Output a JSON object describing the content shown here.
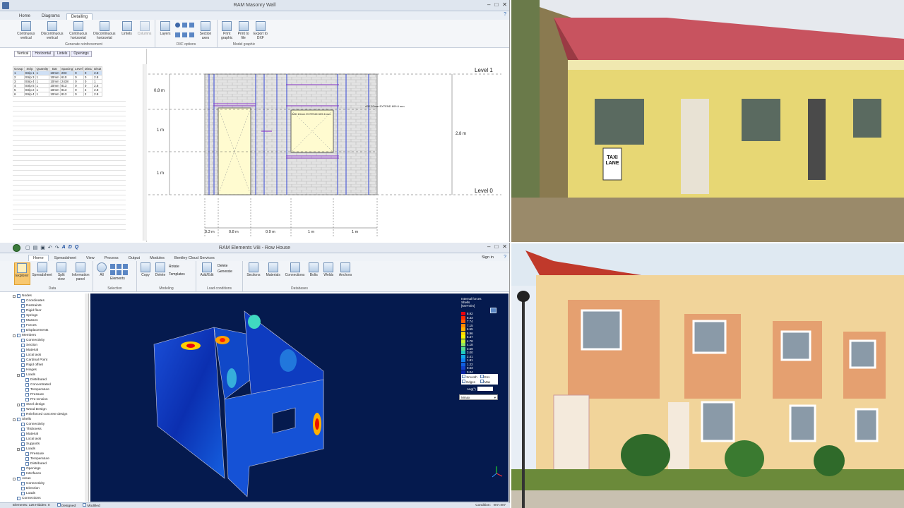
{
  "app1": {
    "title": "RAM Masonry Wall",
    "tabs": [
      "Home",
      "Diagrams",
      "Detailing"
    ],
    "ribbon_groups": [
      {
        "label": "Generate reinforcement",
        "buttons": [
          "Continuous vertical",
          "Discontinuous vertical",
          "Continuous horizontal",
          "Discontinuous horizontal",
          "Lintels",
          "Columns"
        ]
      },
      {
        "label": "DXF options",
        "buttons": [
          "Layers",
          "Section axes"
        ]
      },
      {
        "label": "Model graphic",
        "buttons": [
          "Print graphic",
          "Print to file",
          "Export to DXF"
        ]
      }
    ],
    "subtabs": [
      "Vertical",
      "Horizontal",
      "Lintels",
      "Openings"
    ],
    "table": {
      "headers": [
        "Group",
        "Strip",
        "Quantity",
        "Bar",
        "Spacing",
        "Level",
        "Dist1",
        "Dist2"
      ],
      "rows": [
        [
          "1",
          "Strip 1",
          "1",
          "10mm",
          "203",
          "0",
          "0",
          "2.8"
        ],
        [
          "2",
          "Strip 3",
          "1",
          "10mm",
          "610",
          "0",
          "0",
          "2.8"
        ],
        [
          "3",
          "Strip 4",
          "1",
          "10mm",
          "2438",
          "0",
          "0",
          "1"
        ],
        [
          "4",
          "Strip 5",
          "1",
          "10mm",
          "813",
          "0",
          "0",
          "2.8"
        ],
        [
          "5",
          "Strip 2",
          "1",
          "10mm",
          "813",
          "0",
          "2",
          "2.8"
        ],
        [
          "6",
          "Strip 4",
          "1",
          "10mm",
          "813",
          "0",
          "2",
          "2.8"
        ]
      ]
    },
    "drawing": {
      "level_top": "Level 1",
      "level_bottom": "Level 0",
      "dim_08": "0.8 m",
      "dim_1a": "1 m",
      "dim_1b": "1 m",
      "dim_total": "2.8 m",
      "bottom_dims": [
        "0.3 m",
        "0.8 m",
        "0.9 m",
        "1 m",
        "1 m"
      ],
      "note1": "A00 10mm EXTEND 609.6 mm",
      "note2": "A00 10mm EXTEND 609.6 mm"
    }
  },
  "app2": {
    "title": "RAM Elements V8i - Row House",
    "tabs": [
      "Home",
      "Spreadsheet",
      "View",
      "Process",
      "Output",
      "Modules",
      "Bentley Cloud Services"
    ],
    "signin": "Sign in",
    "ribbon_groups": [
      {
        "label": "Data",
        "buttons": [
          "Explorer",
          "Spreadsheet",
          "Split view",
          "Information panel"
        ]
      },
      {
        "label": "Selection",
        "buttons": [
          "All",
          "Elements"
        ]
      },
      {
        "label": "Modeling",
        "buttons": [
          "Copy",
          "Delete",
          "Rotate",
          "Templates"
        ]
      },
      {
        "label": "Load conditions",
        "buttons": [
          "Add/Edit",
          "Delete",
          "Generate"
        ]
      },
      {
        "label": "Databases",
        "buttons": [
          "Sections",
          "Materials",
          "Connections",
          "Bolts",
          "Welds",
          "Anchors"
        ]
      }
    ],
    "tree": [
      {
        "level": 0,
        "label": "Nodes",
        "expand": true
      },
      {
        "level": 1,
        "label": "Coordinates"
      },
      {
        "level": 1,
        "label": "Restraints"
      },
      {
        "level": 1,
        "label": "Rigid floor"
      },
      {
        "level": 1,
        "label": "Springs"
      },
      {
        "level": 1,
        "label": "Masses"
      },
      {
        "level": 1,
        "label": "Forces"
      },
      {
        "level": 1,
        "label": "Displacements"
      },
      {
        "level": 0,
        "label": "Members",
        "expand": true
      },
      {
        "level": 1,
        "label": "Connectivity"
      },
      {
        "level": 1,
        "label": "Section"
      },
      {
        "level": 1,
        "label": "Material"
      },
      {
        "level": 1,
        "label": "Local axis"
      },
      {
        "level": 1,
        "label": "Cardinal Point"
      },
      {
        "level": 1,
        "label": "Rigid offset"
      },
      {
        "level": 1,
        "label": "Hinges"
      },
      {
        "level": 1,
        "label": "Loads",
        "expand": true
      },
      {
        "level": 2,
        "label": "Distributed"
      },
      {
        "level": 2,
        "label": "Concentrated"
      },
      {
        "level": 2,
        "label": "Temperature"
      },
      {
        "level": 2,
        "label": "Pressure"
      },
      {
        "level": 2,
        "label": "Pre-tension"
      },
      {
        "level": 1,
        "label": "Steel design",
        "expand": true
      },
      {
        "level": 1,
        "label": "Wood Design"
      },
      {
        "level": 1,
        "label": "Reinforced concrete design"
      },
      {
        "level": 0,
        "label": "Shells",
        "expand": true
      },
      {
        "level": 1,
        "label": "Connectivity"
      },
      {
        "level": 1,
        "label": "Thickness"
      },
      {
        "level": 1,
        "label": "Material"
      },
      {
        "level": 1,
        "label": "Local axis"
      },
      {
        "level": 1,
        "label": "Supports"
      },
      {
        "level": 1,
        "label": "Loads",
        "expand": true
      },
      {
        "level": 2,
        "label": "Pressure"
      },
      {
        "level": 2,
        "label": "Temperature"
      },
      {
        "level": 2,
        "label": "Distributed"
      },
      {
        "level": 1,
        "label": "Openings"
      },
      {
        "level": 1,
        "label": "Interfaces"
      },
      {
        "level": 0,
        "label": "Areas",
        "expand": true
      },
      {
        "level": 1,
        "label": "Connectivity"
      },
      {
        "level": 1,
        "label": "Direction"
      },
      {
        "level": 1,
        "label": "Loads"
      },
      {
        "level": 0,
        "label": "Connections"
      }
    ],
    "legend": {
      "title": "Internal forces",
      "sub": "Shells",
      "unit": "[KN*m/m]",
      "values": [
        "8.92",
        "8.33",
        "7.74",
        "7.15",
        "6.55",
        "5.96",
        "5.37",
        "4.78",
        "4.18",
        "3.59",
        "3.00",
        "2.41",
        "1.81",
        "1.22",
        "0.63",
        "0.04"
      ],
      "colors": [
        "#e8000e",
        "#ff2a00",
        "#ff5a00",
        "#ff8800",
        "#ffb000",
        "#ffd800",
        "#f5f500",
        "#c8f030",
        "#90e860",
        "#50d890",
        "#20c8c0",
        "#10a8e8",
        "#1080f0",
        "#1060e0",
        "#1040c8",
        "#0a24a8"
      ],
      "options": [
        "Smooth",
        "Env",
        "Edges",
        "Max"
      ],
      "angle_label": "Ang(°)",
      "select": "Mmax"
    },
    "status": {
      "left": "Elements: 126  Hidden: 0",
      "designed": "Designed",
      "modified": "Modified",
      "condition_label": "Condition:",
      "condition": "W7=W7"
    }
  },
  "photos": {
    "sign_text": "TAXI LANE"
  }
}
